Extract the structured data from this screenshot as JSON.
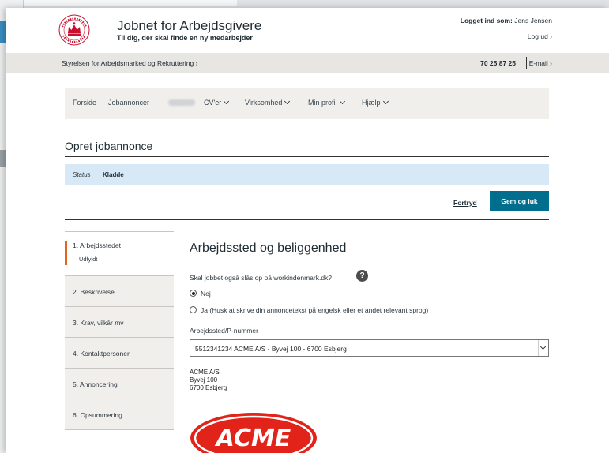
{
  "header": {
    "title": "Jobnet for Arbejdsgivere",
    "subtitle": "Til dig, der skal finde en ny medarbejder",
    "login_prefix": "Logget ind som:",
    "login_user": "Jens Jensen",
    "logout": "Log ud ›"
  },
  "agency_bar": {
    "agency": "Styrelsen for Arbejdsmarked og Rekruttering ›",
    "phone": "70 25 87 25",
    "email": "E-mail ›"
  },
  "nav": {
    "items": [
      {
        "label": "Forside"
      },
      {
        "label": "Jobannoncer"
      },
      {
        "label": "CV'er"
      },
      {
        "label": "Virksomhed"
      },
      {
        "label": "Min profil"
      },
      {
        "label": "Hjælp"
      }
    ]
  },
  "page": {
    "title": "Opret jobannonce",
    "status_label": "Status",
    "status_value": "Kladde",
    "cancel": "Fortryd",
    "save": "Gem og luk"
  },
  "steps": [
    {
      "label": "1. Arbejdsstedet",
      "sub": "Udfyldt"
    },
    {
      "label": "2. Beskrivelse"
    },
    {
      "label": "3. Krav, vilkår mv"
    },
    {
      "label": "4. Kontaktpersoner"
    },
    {
      "label": "5. Annoncering"
    },
    {
      "label": "6. Opsummering"
    }
  ],
  "form": {
    "heading": "Arbejdssted og beliggenhed",
    "question": "Skal jobbet også slås op på workindenmark.dk?",
    "option_no": "Nej",
    "option_yes": "Ja (Husk at skrive din annoncetekst på engelsk eller et andet relevant sprog)",
    "selected_option": "Nej",
    "field_label": "Arbejdssted/P-nummer",
    "select_value": "5512341234 ACME A/S - Byvej 100 - 6700 Esbjerg",
    "address": [
      "ACME A/S",
      "Byvej 100",
      "6700 Esbjerg"
    ],
    "logo_text": "ACME"
  },
  "colors": {
    "primary_button": "#006e8c",
    "status_bar": "#d7e9f6",
    "step_marker": "#e0661d",
    "logo_red": "#e2231a"
  },
  "icons": [
    "crown-logo-icon",
    "help-icon",
    "chevron-down-icon"
  ]
}
